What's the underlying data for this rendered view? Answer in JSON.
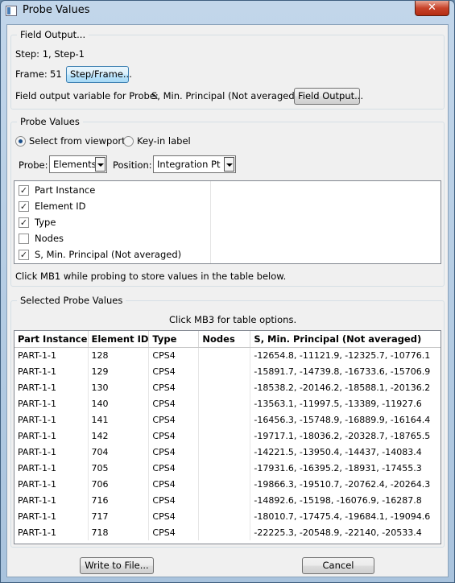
{
  "window": {
    "title": "Probe Values",
    "close_symbol": "✕"
  },
  "field_output": {
    "group_title": "Field Output...",
    "step_text": "Step:  1, Step-1",
    "frame_label": "Frame:",
    "frame_value": "51",
    "step_frame_button": "Step/Frame...",
    "variable_label": "Field output variable for Probe:",
    "variable_value": "S, Min. Principal (Not averaged)",
    "field_output_button": "Field Output..."
  },
  "probe_values": {
    "group_title": "Probe Values",
    "radio_select": "Select from viewport",
    "radio_keyin": "Key-in label",
    "probe_label": "Probe:",
    "probe_value": "Elements",
    "position_label": "Position:",
    "position_value": "Integration Pt",
    "columns": [
      {
        "label": "Part Instance",
        "checked": "✓"
      },
      {
        "label": "Element ID",
        "checked": "✓"
      },
      {
        "label": "Type",
        "checked": "✓"
      },
      {
        "label": "Nodes",
        "checked": ""
      },
      {
        "label": "S, Min. Principal (Not averaged)",
        "checked": "✓"
      }
    ],
    "hint": "Click MB1 while probing to store values in the table below."
  },
  "selected": {
    "group_title": "Selected Probe Values",
    "hint": "Click MB3 for table options.",
    "headers": [
      "Part Instance",
      "Element ID",
      "Type",
      "Nodes",
      "S, Min. Principal (Not averaged)"
    ],
    "rows": [
      [
        "PART-1-1",
        "128",
        "CPS4",
        "",
        "-12654.8, -11121.9, -12325.7, -10776.1"
      ],
      [
        "PART-1-1",
        "129",
        "CPS4",
        "",
        "-15891.7, -14739.8, -16733.6, -15706.9"
      ],
      [
        "PART-1-1",
        "130",
        "CPS4",
        "",
        "-18538.2, -20146.2, -18588.1, -20136.2"
      ],
      [
        "PART-1-1",
        "140",
        "CPS4",
        "",
        "-13563.1, -11997.5, -13389, -11927.6"
      ],
      [
        "PART-1-1",
        "141",
        "CPS4",
        "",
        "-16456.3, -15748.9, -16889.9, -16164.4"
      ],
      [
        "PART-1-1",
        "142",
        "CPS4",
        "",
        "-19717.1, -18036.2, -20328.7, -18765.5"
      ],
      [
        "PART-1-1",
        "704",
        "CPS4",
        "",
        "-14221.5, -13950.4, -14437, -14083.4"
      ],
      [
        "PART-1-1",
        "705",
        "CPS4",
        "",
        "-17931.6, -16395.2, -18931, -17455.3"
      ],
      [
        "PART-1-1",
        "706",
        "CPS4",
        "",
        "-19866.3, -19510.7, -20762.4, -20264.3"
      ],
      [
        "PART-1-1",
        "716",
        "CPS4",
        "",
        "-14892.6, -15198, -16076.9, -16287.8"
      ],
      [
        "PART-1-1",
        "717",
        "CPS4",
        "",
        "-18010.7, -17475.4, -19684.1, -19094.6"
      ],
      [
        "PART-1-1",
        "718",
        "CPS4",
        "",
        "-22225.3, -20548.9, -22140, -20533.4"
      ]
    ]
  },
  "footer": {
    "write_button": "Write to File...",
    "cancel_button": "Cancel"
  }
}
